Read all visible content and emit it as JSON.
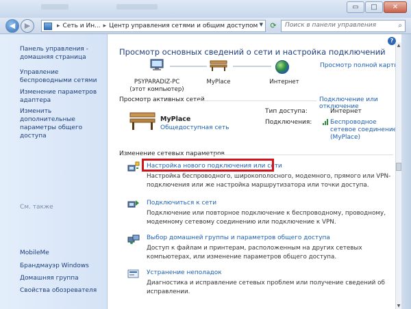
{
  "window": {
    "minimize_label": "▭",
    "maximize_label": "□",
    "close_label": "✕"
  },
  "address": {
    "back_label": "◀",
    "forward_label": "▶",
    "crumb1": "Сеть и Ин...",
    "crumb2": "Центр управления сетями и общим доступом",
    "search_placeholder": "Поиск в панели управления"
  },
  "sidebar": {
    "items": [
      {
        "label": "Панель управления - домашняя страница"
      },
      {
        "label": "Управление беспроводными сетями"
      },
      {
        "label": "Изменение параметров адаптера"
      },
      {
        "label": "Изменить дополнительные параметры общего доступа"
      }
    ],
    "see_also": "См. также",
    "see_also_items": [
      {
        "label": "MobileMe"
      },
      {
        "label": "Брандмауэр Windows"
      },
      {
        "label": "Домашняя группа"
      },
      {
        "label": "Свойства обозревателя"
      }
    ]
  },
  "main": {
    "heading": "Просмотр основных сведений о сети и настройка подключений",
    "full_map_link": "Просмотр полной карты",
    "map": {
      "computer_name": "PSYPARADIZ-PC",
      "computer_note": "(этот компьютер)",
      "network_name": "MyPlace",
      "internet_label": "Интернет"
    },
    "active_title": "Просмотр активных сетей",
    "connect_link": "Подключение или отключение",
    "active": {
      "name": "MyPlace",
      "type": "Общедоступная сеть",
      "access_key": "Тип доступа:",
      "access_value": "Интернет",
      "connections_key": "Подключения:",
      "connections_value_line1": "Беспроводное",
      "connections_value_line2": "сетевое соединение",
      "connections_value_line3": "(MyPlace)"
    },
    "change_title": "Изменение сетевых параметров",
    "tasks": [
      {
        "title": "Настройка нового подключения или сети",
        "desc": "Настройка беспроводного, широкополосного, модемного, прямого или VPN-подключения или же настройка маршрутизатора или точки доступа."
      },
      {
        "title": "Подключиться к сети",
        "desc": "Подключение или повторное подключение к беспроводному, проводному, модемному сетевому соединению или подключение к VPN."
      },
      {
        "title": "Выбор домашней группы и параметров общего доступа",
        "desc": "Доступ к файлам и принтерам, расположенным на других сетевых компьютерах, или изменение параметров общего доступа."
      },
      {
        "title": "Устранение неполадок",
        "desc": "Диагностика и исправление сетевых проблем или получение сведений об исправлении."
      }
    ]
  },
  "colors": {
    "link": "#1b5fb5",
    "heading": "#1e3e7d",
    "highlight": "#d3131a"
  }
}
